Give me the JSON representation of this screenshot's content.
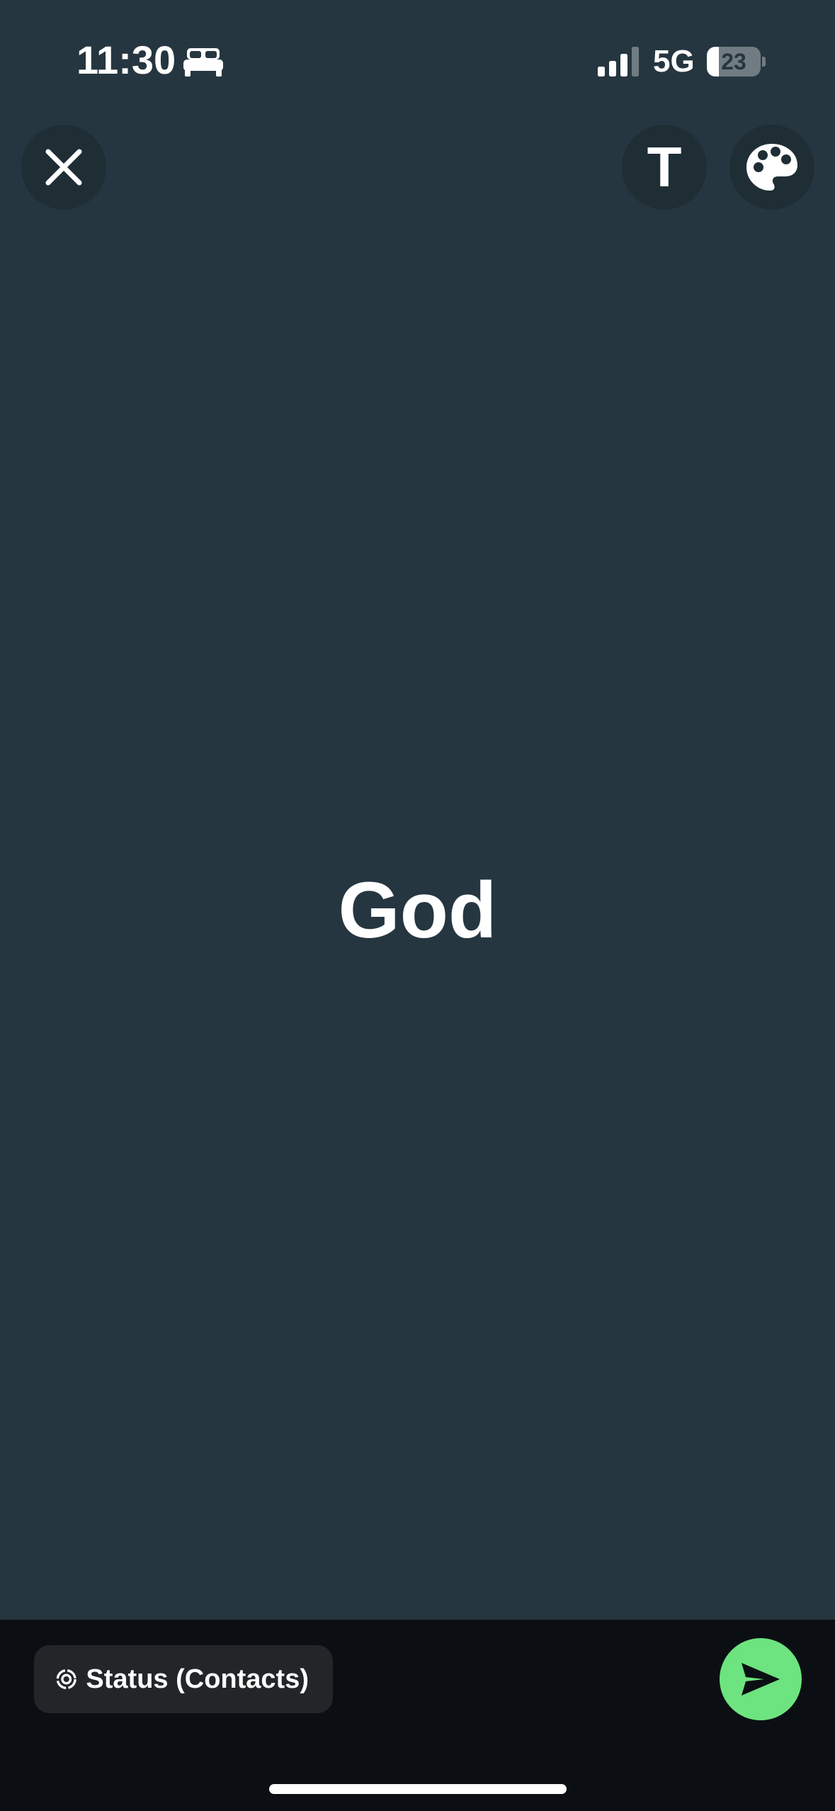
{
  "status_bar": {
    "time": "11:30",
    "sleep_icon": "bed-icon",
    "signal_icon": "cellular-signal-icon",
    "network": "5G",
    "battery_level": "23",
    "battery_fraction": 0.23
  },
  "top_controls": {
    "close_icon": "close-icon",
    "text_tool_label": "T",
    "palette_icon": "palette-icon"
  },
  "content": {
    "status_text": "God"
  },
  "bottom_bar": {
    "audience_icon": "status-ring-icon",
    "audience_label": "Status (Contacts)",
    "send_icon": "send-icon"
  },
  "colors": {
    "background": "#263640",
    "bottom_bar": "#0b0f13",
    "send_button": "#6de47f",
    "chip": "#222628",
    "control_button": "#1f2d35"
  }
}
